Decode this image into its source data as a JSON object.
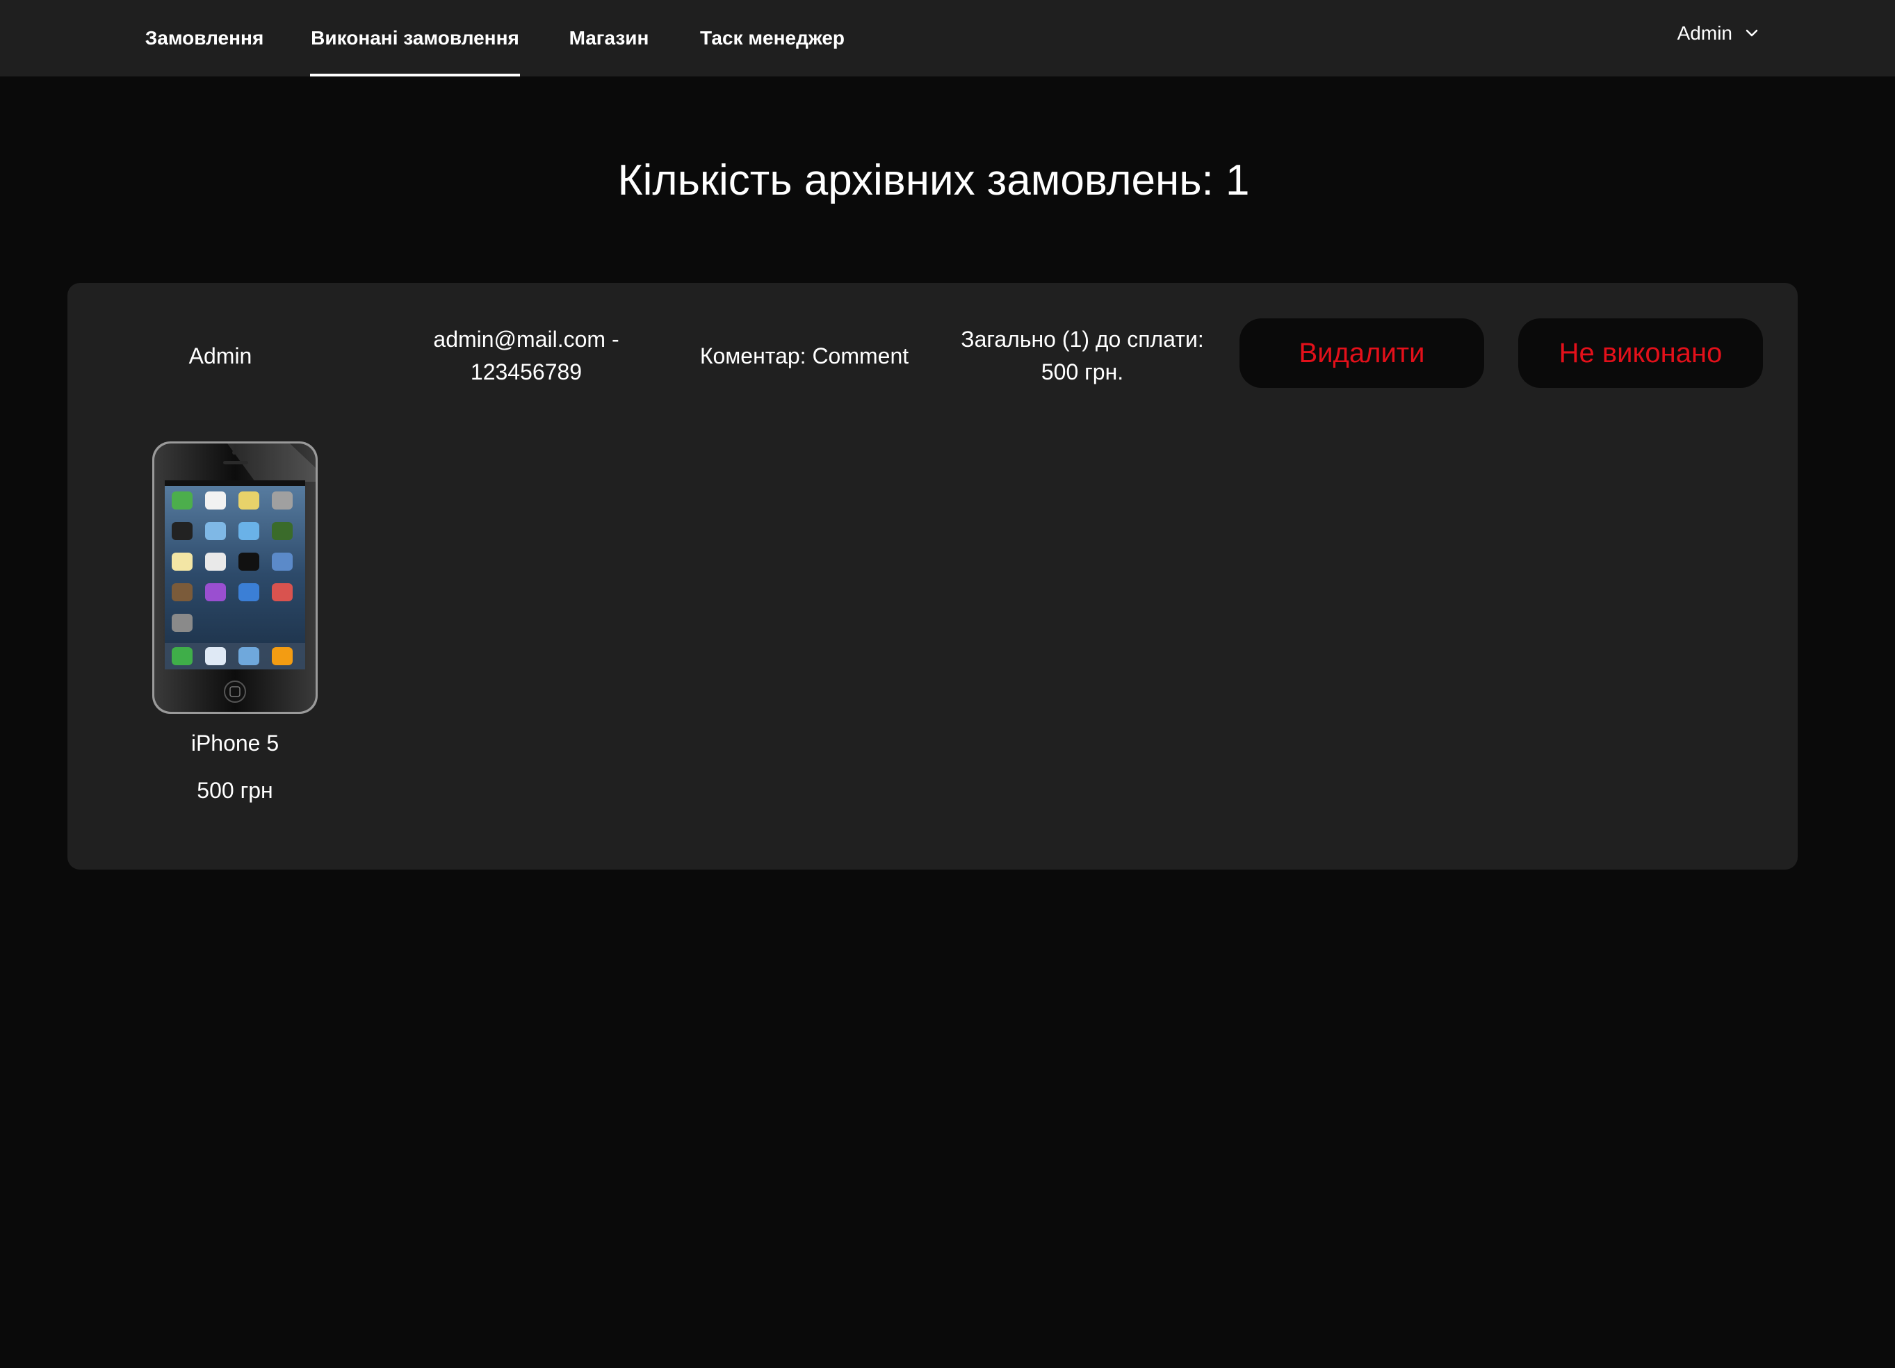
{
  "nav": {
    "items": [
      {
        "label": "Замовлення",
        "active": false
      },
      {
        "label": "Виконані замовлення",
        "active": true
      },
      {
        "label": "Магазин",
        "active": false
      },
      {
        "label": "Таск менеджер",
        "active": false
      }
    ],
    "user_label": "Admin",
    "user_icon": "chevron-down-icon"
  },
  "page": {
    "title": "Кількість архівних замовлень: 1"
  },
  "order": {
    "customer_name": "Admin",
    "contact_line1": "admin@mail.com -",
    "contact_line2": "123456789",
    "comment": "Коментар: Comment",
    "total_line1": "Загально (1) до сплати:",
    "total_line2": "500 грн.",
    "delete_label": "Видалити",
    "not_done_label": "Не виконано",
    "items": [
      {
        "name": "iPhone 5",
        "price": "500 грн"
      }
    ]
  },
  "colors": {
    "background": "#0a0a0a",
    "topbar": "#1f1f1f",
    "card": "#202020",
    "danger": "#e3101a"
  }
}
